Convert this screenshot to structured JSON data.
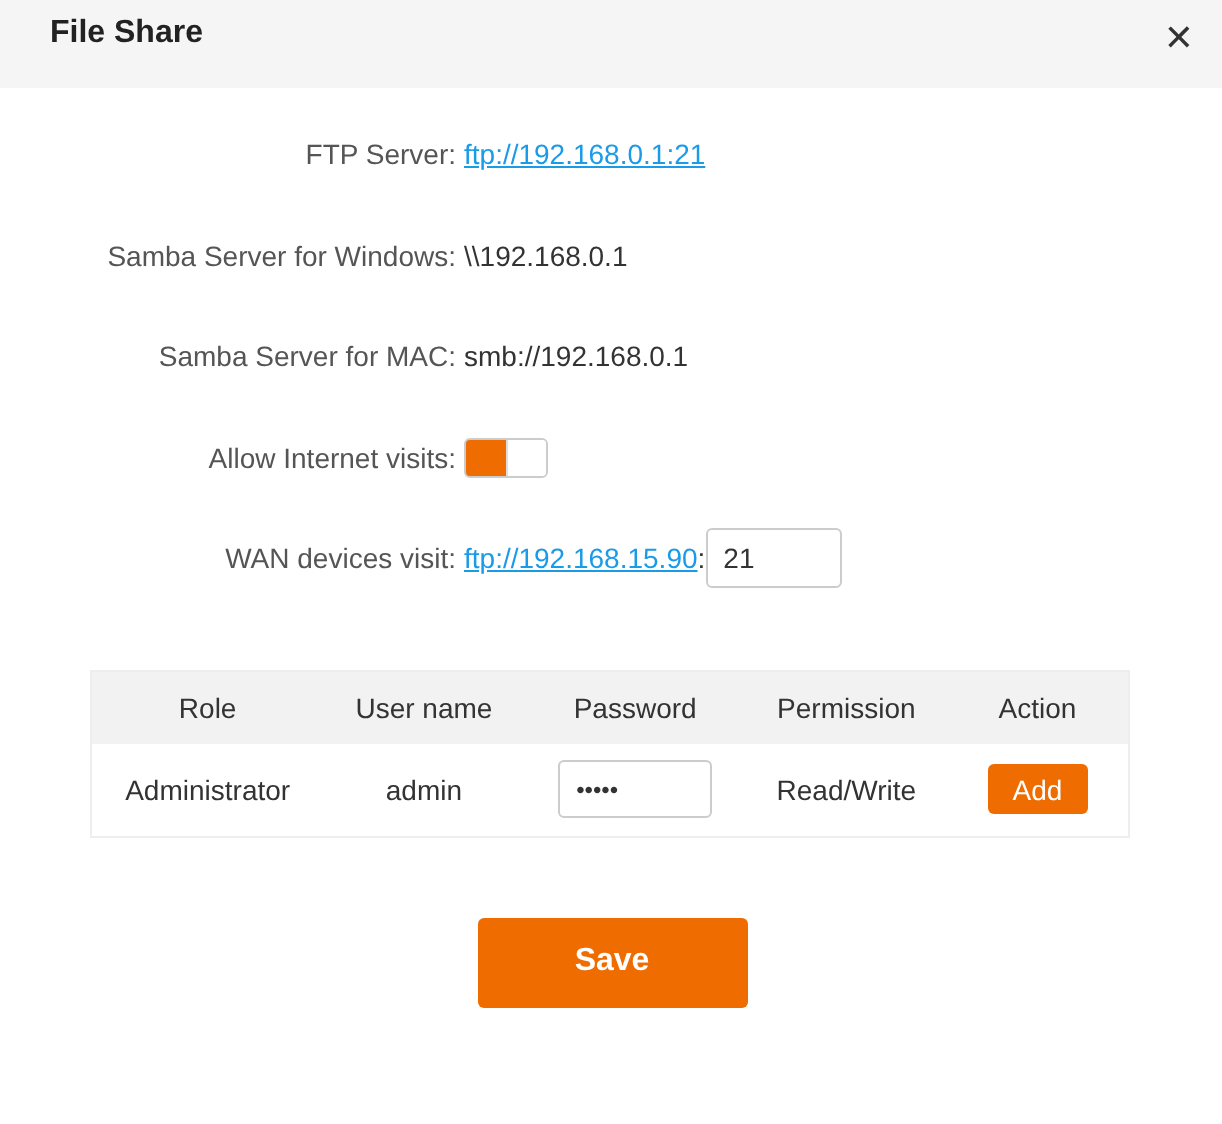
{
  "dialog": {
    "title": "File Share",
    "close": "✕"
  },
  "fields": [
    {
      "kind": "link",
      "label": "FTP Server:",
      "value": "ftp://192.168.0.1:21"
    },
    {
      "kind": "text",
      "label": "Samba Server for Windows:",
      "value": "\\\\192.168.0.1"
    },
    {
      "kind": "text",
      "label": "Samba Server for MAC:",
      "value": "smb://192.168.0.1"
    },
    {
      "kind": "toggle",
      "label": "Allow Internet visits:",
      "on": true
    },
    {
      "kind": "link_port",
      "label": "WAN devices visit:",
      "value": "ftp://192.168.15.90",
      "separator": ":",
      "port": "21"
    }
  ],
  "table": {
    "columns": [
      "Role",
      "User name",
      "Password",
      "Permission",
      "Action"
    ],
    "rows": [
      {
        "role": "Administrator",
        "user": "admin",
        "password": "•••••",
        "permission": "Read/Write",
        "action": "Add"
      }
    ]
  },
  "save": "Save"
}
